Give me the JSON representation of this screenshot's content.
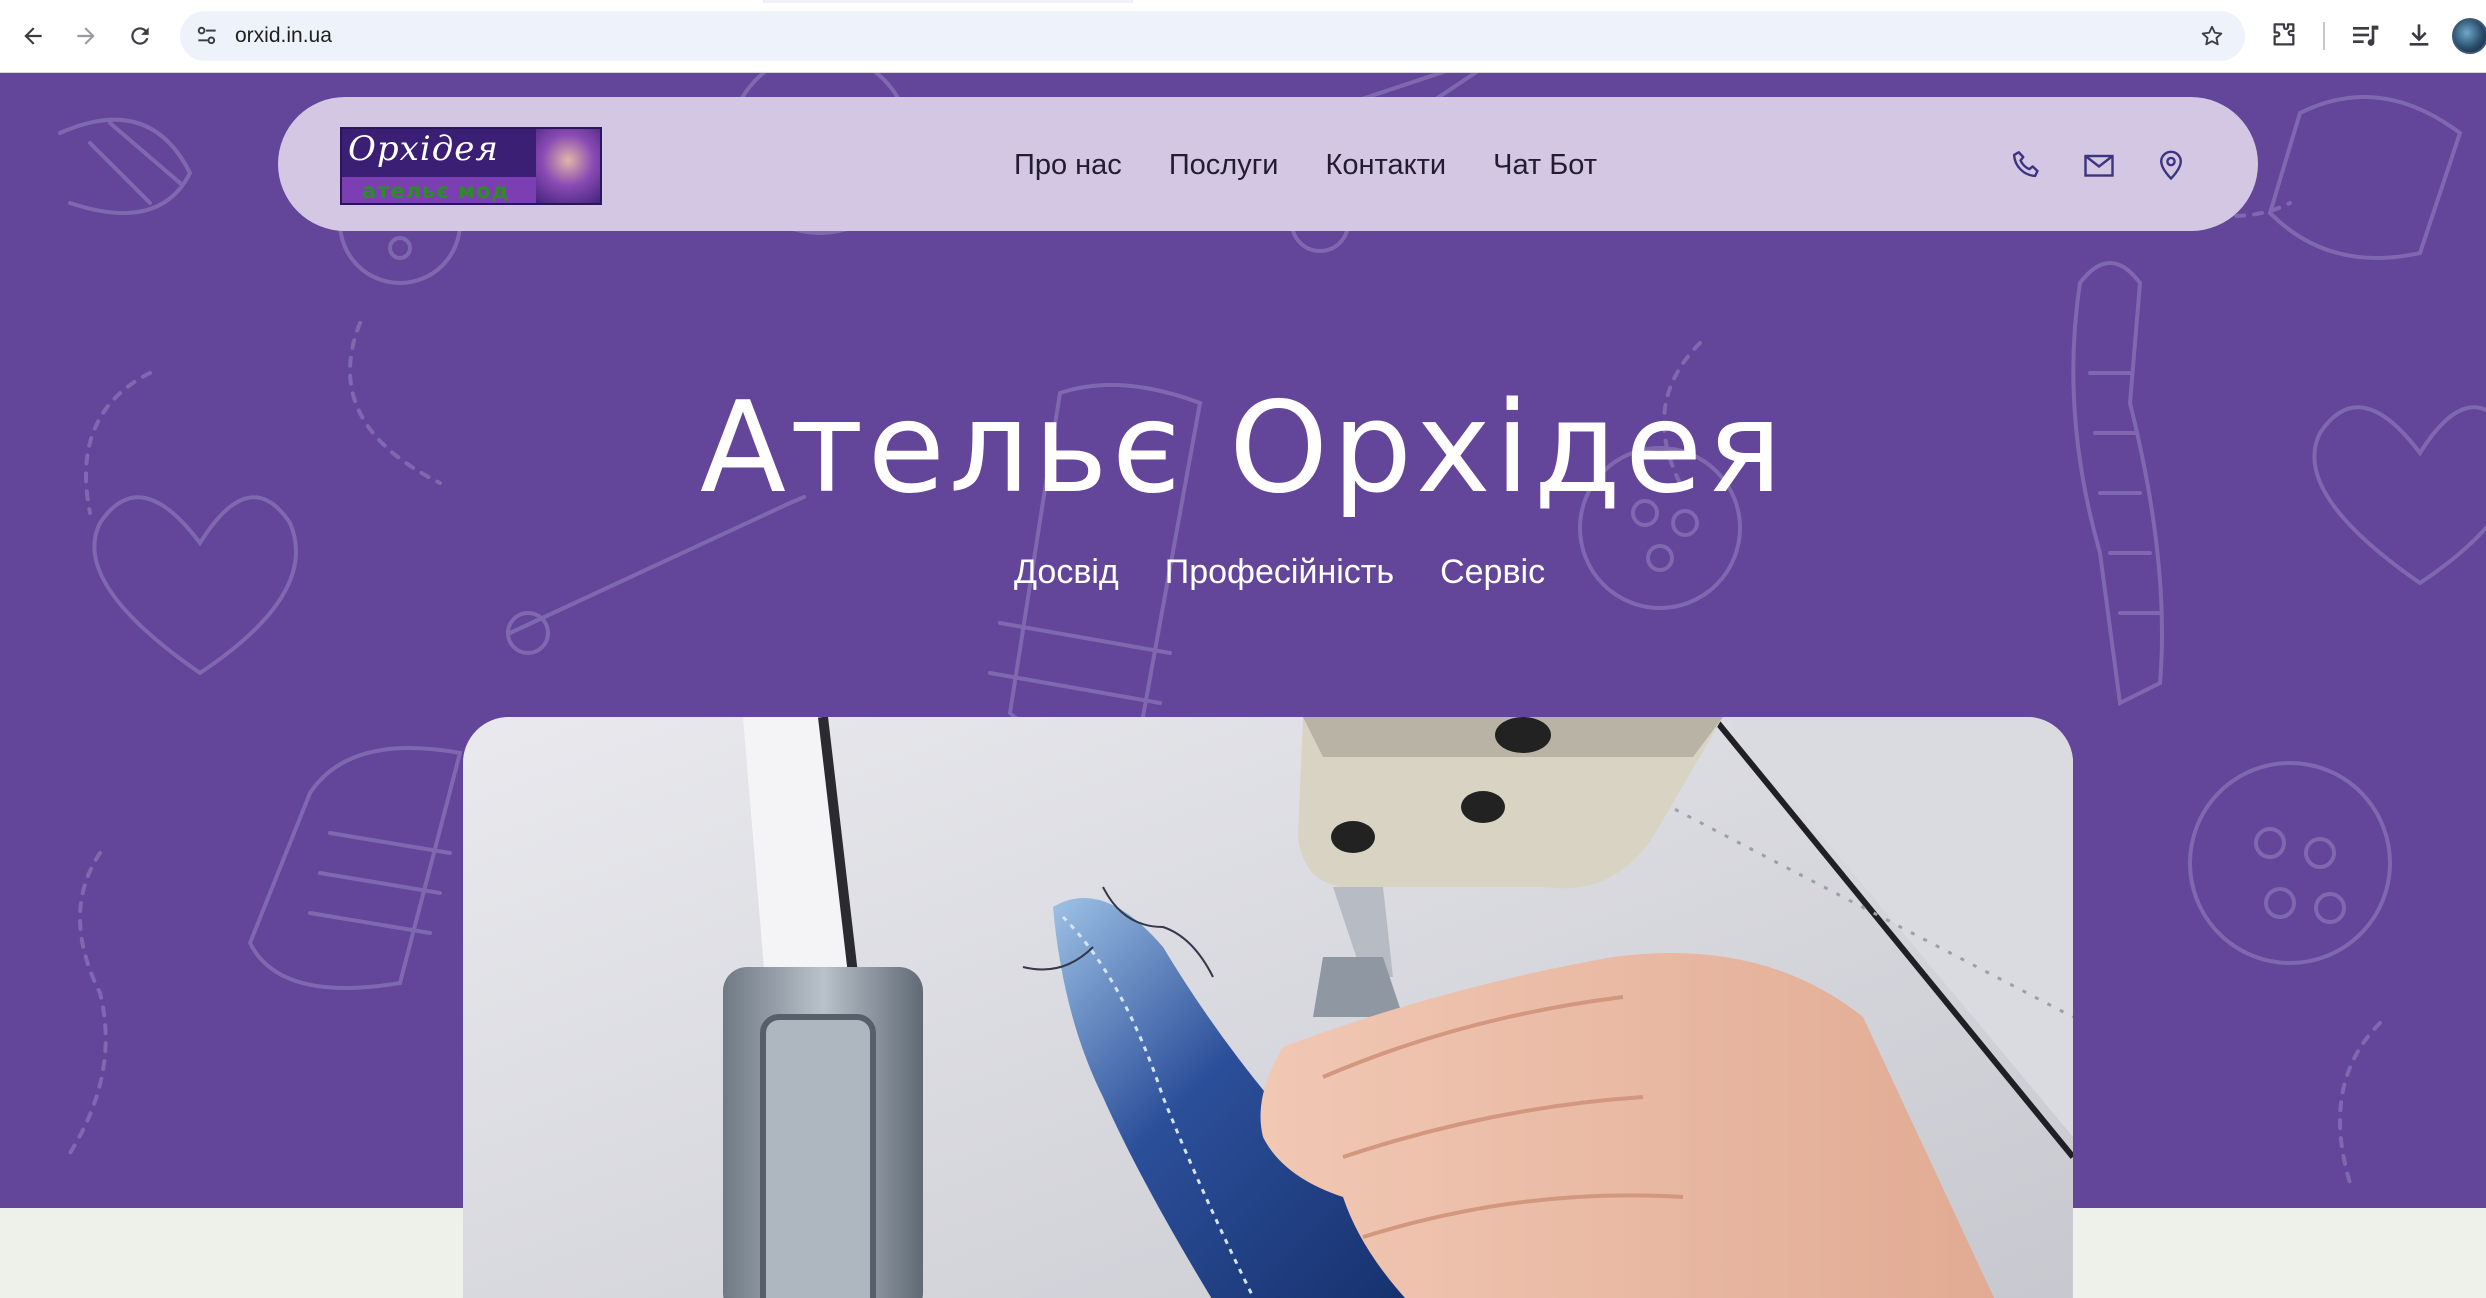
{
  "browser": {
    "url": "orxid.in.ua",
    "icons": {
      "back": "arrow-left-icon",
      "forward": "arrow-right-icon",
      "reload": "reload-icon",
      "site_info": "tune-icon",
      "bookmark": "star-icon",
      "extensions": "puzzle-icon",
      "media": "playlist-icon",
      "downloads": "download-icon",
      "profile": "avatar"
    }
  },
  "header": {
    "logo": {
      "title": "Орхідея",
      "subtitle": "ательє мод"
    },
    "menu": [
      {
        "label": "Про нас"
      },
      {
        "label": "Послуги"
      },
      {
        "label": "Контакти"
      },
      {
        "label": "Чат Бот"
      }
    ],
    "contact_icons": [
      "phone-icon",
      "mail-icon",
      "location-pin-icon"
    ]
  },
  "hero": {
    "title": "Ательє Орхідея",
    "features": [
      "Досвід",
      "Професійність",
      "Сервіс"
    ]
  },
  "colors": {
    "hero_background": "#634599",
    "header_background": "#d3c7e3",
    "page_background": "#eef0ea",
    "text_light": "#ffffff",
    "text_dark": "#231d33"
  }
}
